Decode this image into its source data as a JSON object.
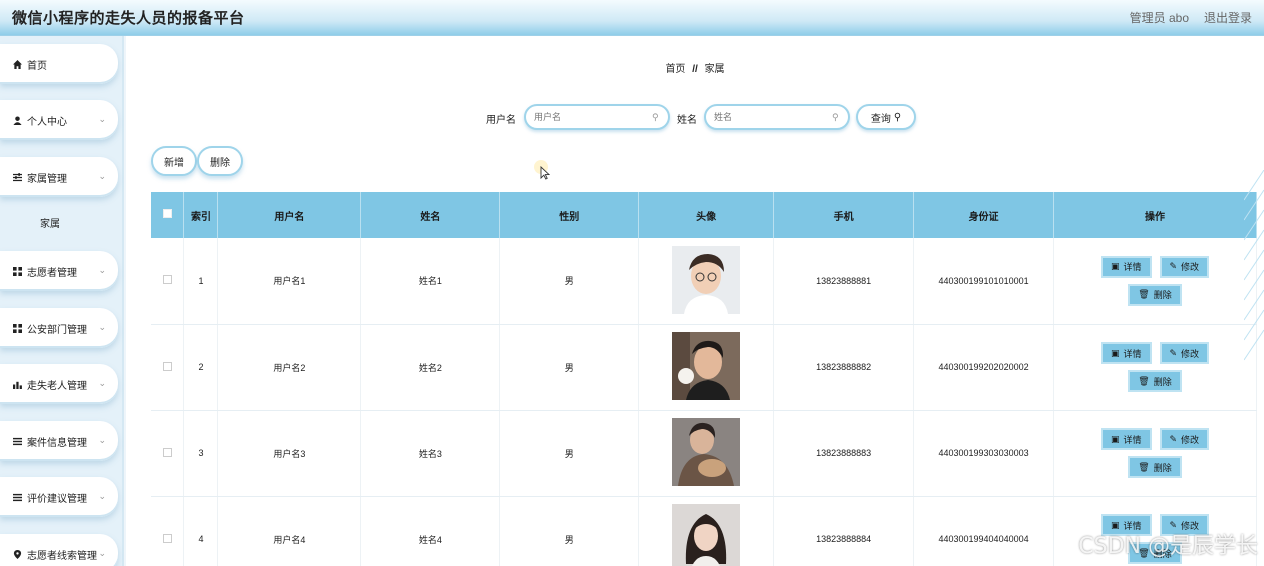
{
  "header": {
    "title": "微信小程序的走失人员的报备平台",
    "admin_label": "管理员 abo",
    "logout_label": "退出登录"
  },
  "sidebar": {
    "items": [
      {
        "label": "首页",
        "icon": "home-icon",
        "has_chevron": false
      },
      {
        "label": "个人中心",
        "icon": "user-icon",
        "has_chevron": true
      },
      {
        "label": "家属管理",
        "icon": "sliders-icon",
        "has_chevron": true
      },
      {
        "label": "志愿者管理",
        "icon": "grid-icon",
        "has_chevron": true
      },
      {
        "label": "公安部门管理",
        "icon": "grid-icon",
        "has_chevron": true
      },
      {
        "label": "走失老人管理",
        "icon": "chart-icon",
        "has_chevron": true
      },
      {
        "label": "案件信息管理",
        "icon": "list-icon",
        "has_chevron": true
      },
      {
        "label": "评价建议管理",
        "icon": "list-icon",
        "has_chevron": true
      },
      {
        "label": "志愿者线索管理",
        "icon": "pin-icon",
        "has_chevron": true
      }
    ],
    "sub_item": "家属"
  },
  "breadcrumb": {
    "home": "首页",
    "separator": "//",
    "current": "家属"
  },
  "search": {
    "username_label": "用户名",
    "username_placeholder": "用户名",
    "name_label": "姓名",
    "name_placeholder": "姓名",
    "query_label": "查询"
  },
  "actions": {
    "add_label": "新增",
    "delete_label": "删除"
  },
  "table": {
    "columns": [
      "索引",
      "用户名",
      "姓名",
      "性别",
      "头像",
      "手机",
      "身份证",
      "操作"
    ],
    "rows": [
      {
        "index": "1",
        "username": "用户名1",
        "name": "姓名1",
        "gender": "男",
        "phone": "13823888881",
        "id_card": "440300199101010001"
      },
      {
        "index": "2",
        "username": "用户名2",
        "name": "姓名2",
        "gender": "男",
        "phone": "13823888882",
        "id_card": "440300199202020002"
      },
      {
        "index": "3",
        "username": "用户名3",
        "name": "姓名3",
        "gender": "男",
        "phone": "13823888883",
        "id_card": "440300199303030003"
      },
      {
        "index": "4",
        "username": "用户名4",
        "name": "姓名4",
        "gender": "男",
        "phone": "13823888884",
        "id_card": "440300199404040004"
      }
    ],
    "op_detail": "详情",
    "op_edit": "修改",
    "op_delete": "删除"
  },
  "watermark": "CSDN @是辰学长",
  "colors": {
    "accent": "#7fc6e4",
    "border": "#9fd4ea"
  }
}
